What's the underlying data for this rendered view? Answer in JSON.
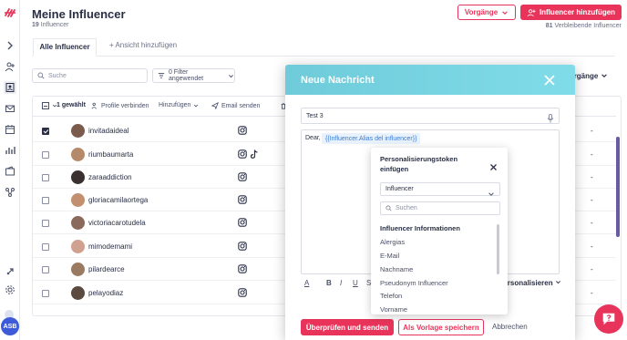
{
  "page": {
    "title": "Meine Influencer",
    "count": "19",
    "count_label": "Influencer",
    "remaining_count": "81",
    "remaining_label": "Verbleibende Influencer"
  },
  "header_buttons": {
    "vorgange": "Vorgänge",
    "add_influencer": "Influencer hinzufügen"
  },
  "tabs": {
    "active": "Alle Influencer",
    "add_view": "Ansicht hinzufügen"
  },
  "filters": {
    "search_placeholder": "Suche",
    "filter_label": "0 Filter angewendet",
    "vorgange_label": "Vorgänge"
  },
  "toolbar": {
    "selected": "1 gewählt",
    "connect": "Profile verbinden",
    "add": "Hinzufügen",
    "email": "Email senden"
  },
  "rows": [
    {
      "name": "invitadaideal",
      "checked": true,
      "tiktok": false,
      "avatar_color": "#7a5a4a",
      "value": "-"
    },
    {
      "name": "riumbaumarta",
      "checked": false,
      "tiktok": true,
      "avatar_color": "#b48a6a",
      "value": "-"
    },
    {
      "name": "zaraaddiction",
      "checked": false,
      "tiktok": false,
      "avatar_color": "#3a3030",
      "value": "-"
    },
    {
      "name": "gloriacamilaortega",
      "checked": false,
      "tiktok": false,
      "avatar_color": "#c29070",
      "value": "-"
    },
    {
      "name": "victoriacarotudela",
      "checked": false,
      "tiktok": false,
      "avatar_color": "#8a6a5a",
      "value": "-"
    },
    {
      "name": "mimodemami",
      "checked": false,
      "tiktok": false,
      "avatar_color": "#d0a090",
      "value": "-"
    },
    {
      "name": "pilardearce",
      "checked": false,
      "tiktok": false,
      "avatar_color": "#9a7a60",
      "value": "-"
    },
    {
      "name": "pelayodiaz",
      "checked": false,
      "tiktok": false,
      "avatar_color": "#5a4a40",
      "value": "-"
    }
  ],
  "modal": {
    "title": "Neue Nachricht",
    "subject": "Test 3",
    "greeting": "Dear,",
    "token": "{{Influencer.Alias del influencer}}",
    "personalize": "Personalisieren",
    "btn_review": "Überprüfen und senden",
    "btn_template": "Als Vorlage speichern",
    "btn_cancel": "Abbrechen"
  },
  "token_popup": {
    "title": "Personalisierungstoken einfügen",
    "select_value": "Influencer",
    "search_placeholder": "Suchen",
    "section": "Influencer Informationen",
    "items": [
      "Alergias",
      "E-Mail",
      "Nachname",
      "Pseudonym Influencer",
      "Telefon",
      "Vorname"
    ]
  },
  "sidebar": {
    "avatar_initials": "ASB"
  },
  "colors": {
    "brand": "#e8345a",
    "modal_header": "#6fcbd9",
    "token_text": "#3a7bd5"
  }
}
